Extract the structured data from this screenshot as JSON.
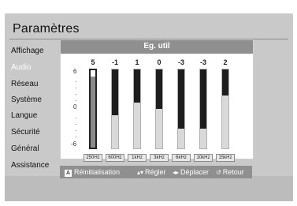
{
  "panel": {
    "title": "Paramètres"
  },
  "menu": {
    "items": [
      {
        "label": "Affichage",
        "dim": false
      },
      {
        "label": "Audio",
        "dim": true
      },
      {
        "label": "Réseau",
        "dim": false
      },
      {
        "label": "Système",
        "dim": false
      },
      {
        "label": "Langue",
        "dim": false
      },
      {
        "label": "Sécurité",
        "dim": false
      },
      {
        "label": "Général",
        "dim": false
      },
      {
        "label": "Assistance",
        "dim": false
      }
    ]
  },
  "dialog": {
    "title": "Eg. util",
    "scale": {
      "top": "6",
      "mid": "0",
      "bottom": "-6"
    },
    "bands": [
      {
        "freq": "250Hz",
        "value": "5",
        "level": 5
      },
      {
        "freq": "600Hz",
        "value": "-1",
        "level": -1
      },
      {
        "freq": "1kHz",
        "value": "1",
        "level": 1
      },
      {
        "freq": "3kHz",
        "value": "0",
        "level": 0
      },
      {
        "freq": "6kHz",
        "value": "-3",
        "level": -3
      },
      {
        "freq": "10kHz",
        "value": "-3",
        "level": -3
      },
      {
        "freq": "15kHz",
        "value": "2",
        "level": 2
      }
    ],
    "selected_band": 0
  },
  "footer": {
    "reset_key": "A",
    "reset_label": "Réinitialisation",
    "adjust_icon": "up-down-arrows-icon",
    "adjust_label": "Régler",
    "move_icon": "left-right-arrows-icon",
    "move_label": "Déplacer",
    "return_icon": "return-icon",
    "return_label": "Retour"
  }
}
